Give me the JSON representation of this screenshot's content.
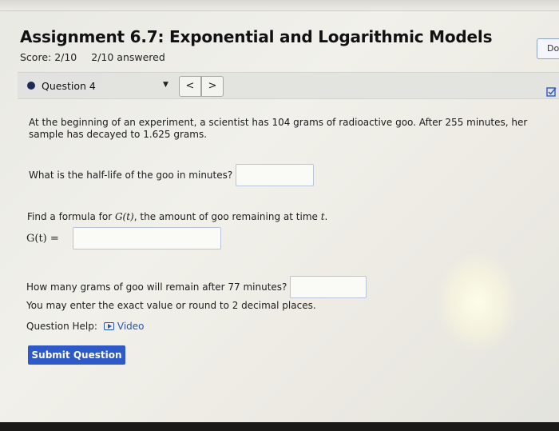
{
  "assignment": {
    "title": "Assignment 6.7: Exponential and Logarithmic Models",
    "score": "Score: 2/10",
    "answered": "2/10 answered",
    "do_button": "Do"
  },
  "question_nav": {
    "selected": "Question 4",
    "prev_label": "<",
    "next_label": ">"
  },
  "problem": {
    "text": "At the beginning of an experiment, a scientist has 104 grams of radioactive goo. After 255 minutes, her sample has decayed to 1.625 grams.",
    "q1": "What is the half-life of the goo in minutes?",
    "q2_prefix": "Find a formula for ",
    "q2_fn": "G(t)",
    "q2_suffix": ", the amount of goo remaining at time ",
    "q2_var": "t",
    "q2_end": ".",
    "q2_eq_label": "G(t) =",
    "q3": "How many grams of goo will remain after 77 minutes?",
    "hint": "You may enter the exact value or round to 2 decimal places.",
    "help_label": "Question Help:",
    "video_label": "Video",
    "submit_label": "Submit Question"
  }
}
